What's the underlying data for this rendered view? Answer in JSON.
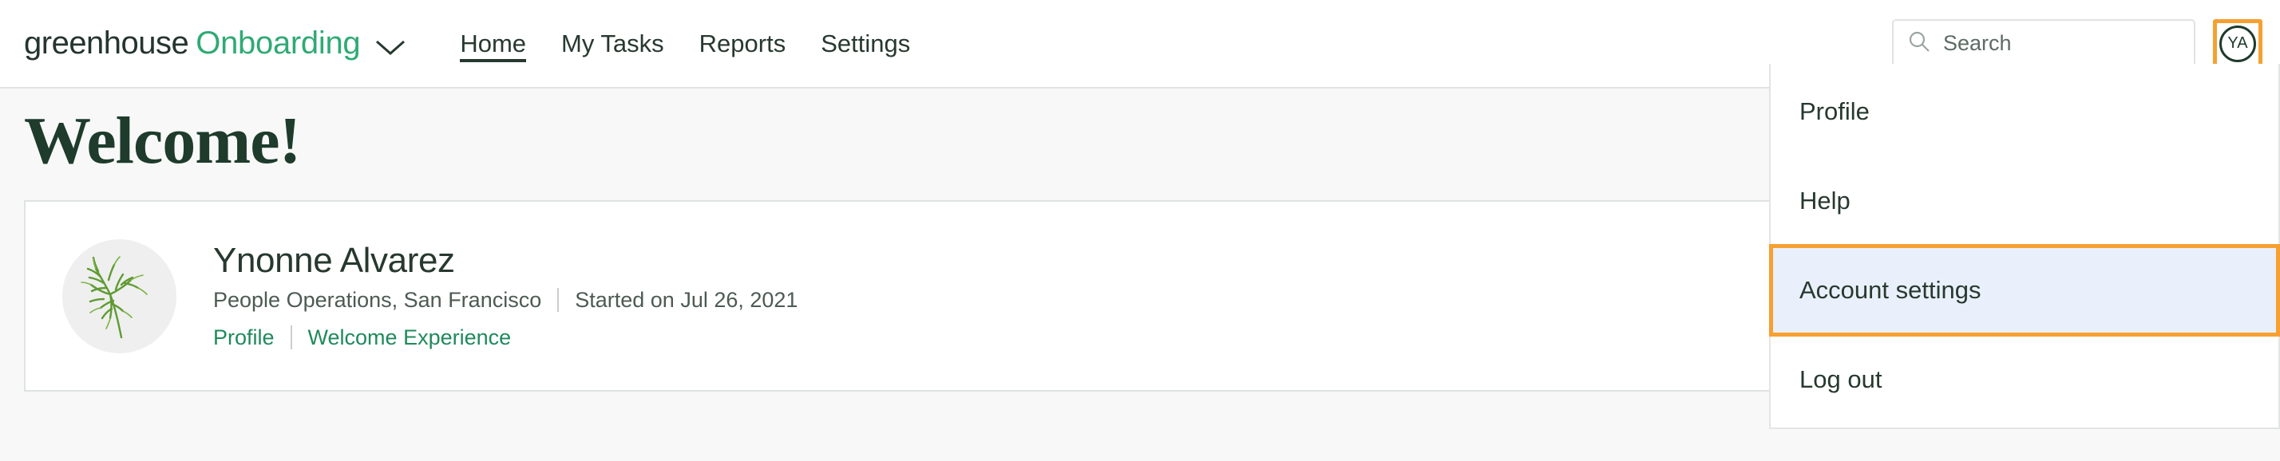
{
  "brand": {
    "name_primary": "greenhouse",
    "name_secondary": "Onboarding",
    "chevron_icon": "chevron-down-icon",
    "color_primary": "#24352e",
    "color_secondary": "#2faa74"
  },
  "nav": {
    "items": [
      {
        "label": "Home",
        "active": true
      },
      {
        "label": "My Tasks",
        "active": false
      },
      {
        "label": "Reports",
        "active": false
      },
      {
        "label": "Settings",
        "active": false
      }
    ]
  },
  "search": {
    "icon": "search-icon",
    "placeholder": "Search",
    "value": ""
  },
  "account": {
    "avatar_initials": "YA",
    "highlight_color": "#f6a030"
  },
  "dropdown": {
    "items": [
      {
        "label": "Profile",
        "highlighted": false
      },
      {
        "label": "Help",
        "highlighted": false
      },
      {
        "label": "Account settings",
        "highlighted": true
      },
      {
        "label": "Log out",
        "highlighted": false
      }
    ],
    "highlight_bg": "#e9f0fb",
    "highlight_border": "#f6a030"
  },
  "main": {
    "title": "Welcome!",
    "profile_card": {
      "avatar_icon": "sprig-plant-icon",
      "name": "Ynonne Alvarez",
      "department_location": "People Operations, San Francisco",
      "start_date": "Started on Jul 26, 2021",
      "links": [
        {
          "label": "Profile"
        },
        {
          "label": "Welcome Experience"
        }
      ]
    }
  }
}
